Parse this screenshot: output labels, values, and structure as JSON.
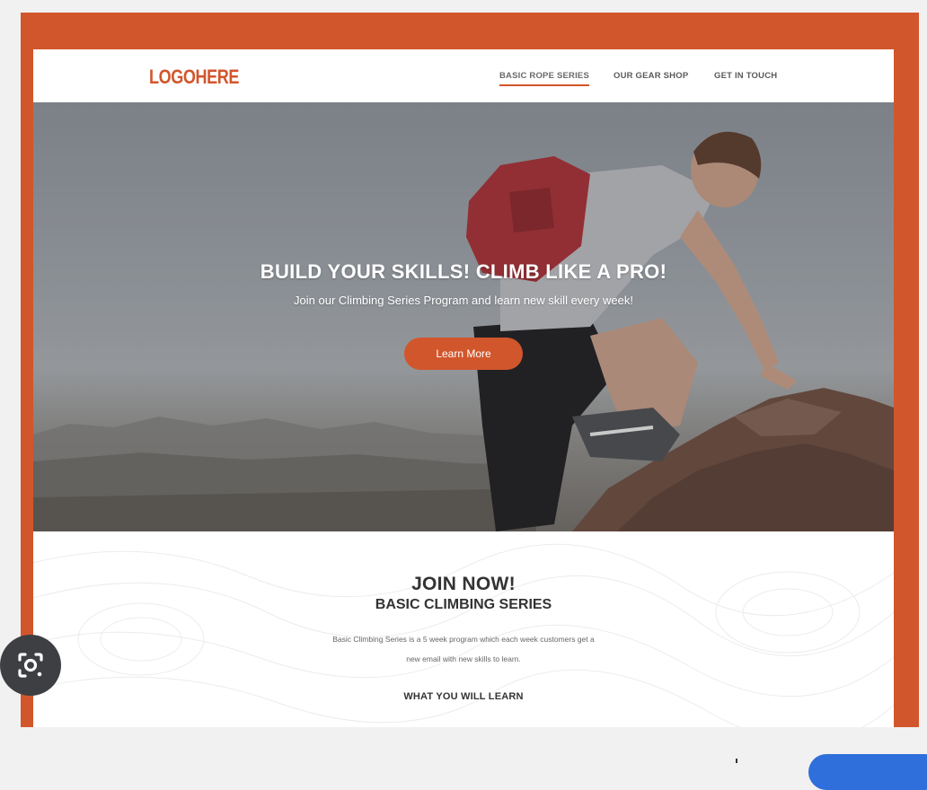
{
  "logo": {
    "text": "LOGOHERE"
  },
  "nav": {
    "items": [
      {
        "label": "BASIC ROPE SERIES",
        "active": true
      },
      {
        "label": "OUR GEAR SHOP",
        "active": false
      },
      {
        "label": "GET IN TOUCH",
        "active": false
      }
    ]
  },
  "hero": {
    "title": "BUILD YOUR SKILLS! CLIMB LIKE A PRO!",
    "subtitle": "Join our Climbing Series Program and learn new skill every week!",
    "cta_label": "Learn More"
  },
  "section": {
    "title": "JOIN NOW!",
    "subtitle": "BASIC CLIMBING SERIES",
    "description_line1": "Basic Climbing Series is a 5 week program which each week customers get a",
    "description_line2": "new email with new skills to learn.",
    "learn_heading": "WHAT YOU WILL LEARN"
  },
  "colors": {
    "accent": "#d2562c",
    "frame": "#d2562c",
    "text_dark": "#333333"
  },
  "icons": {
    "lens": "google-lens-icon"
  }
}
